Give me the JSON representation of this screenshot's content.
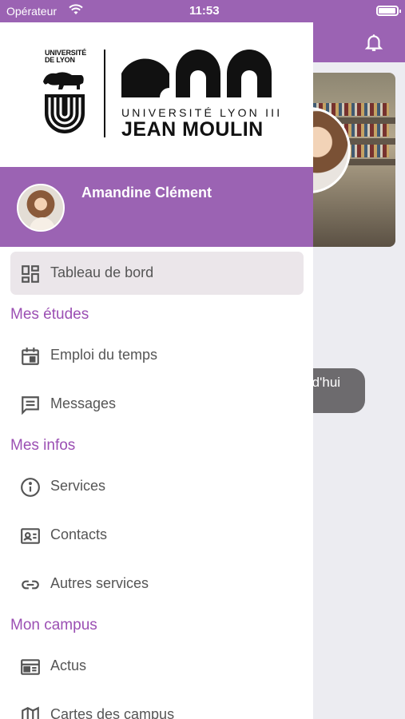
{
  "status_bar": {
    "carrier": "Opérateur",
    "time": "11:53"
  },
  "logo": {
    "left_text_line1": "UNIVERSITÉ",
    "left_text_line2": "DE LYON",
    "right_text_line1": "UNIVERSITÉ LYON III",
    "right_text_line2": "JEAN MOULIN"
  },
  "profile": {
    "name": "Amandine Clément"
  },
  "menu": {
    "dashboard": "Tableau de bord",
    "sections": {
      "studies": "Mes études",
      "infos": "Mes infos",
      "campus": "Mon campus"
    },
    "items": {
      "schedule": "Emploi du temps",
      "messages": "Messages",
      "services": "Services",
      "contacts": "Contacts",
      "other_services": "Autres services",
      "news": "Actus",
      "campus_maps": "Cartes des campus"
    }
  },
  "background": {
    "pill_text": "rd'hui"
  },
  "colors": {
    "accent": "#9b63b3",
    "section_text": "#9b4fb3",
    "active_item_bg": "#ebe6ea"
  },
  "icons": [
    "wifi-icon",
    "battery-icon",
    "bell-icon",
    "dashboard-icon",
    "calendar-icon",
    "message-icon",
    "info-icon",
    "contact-card-icon",
    "link-icon",
    "news-icon",
    "map-icon"
  ]
}
